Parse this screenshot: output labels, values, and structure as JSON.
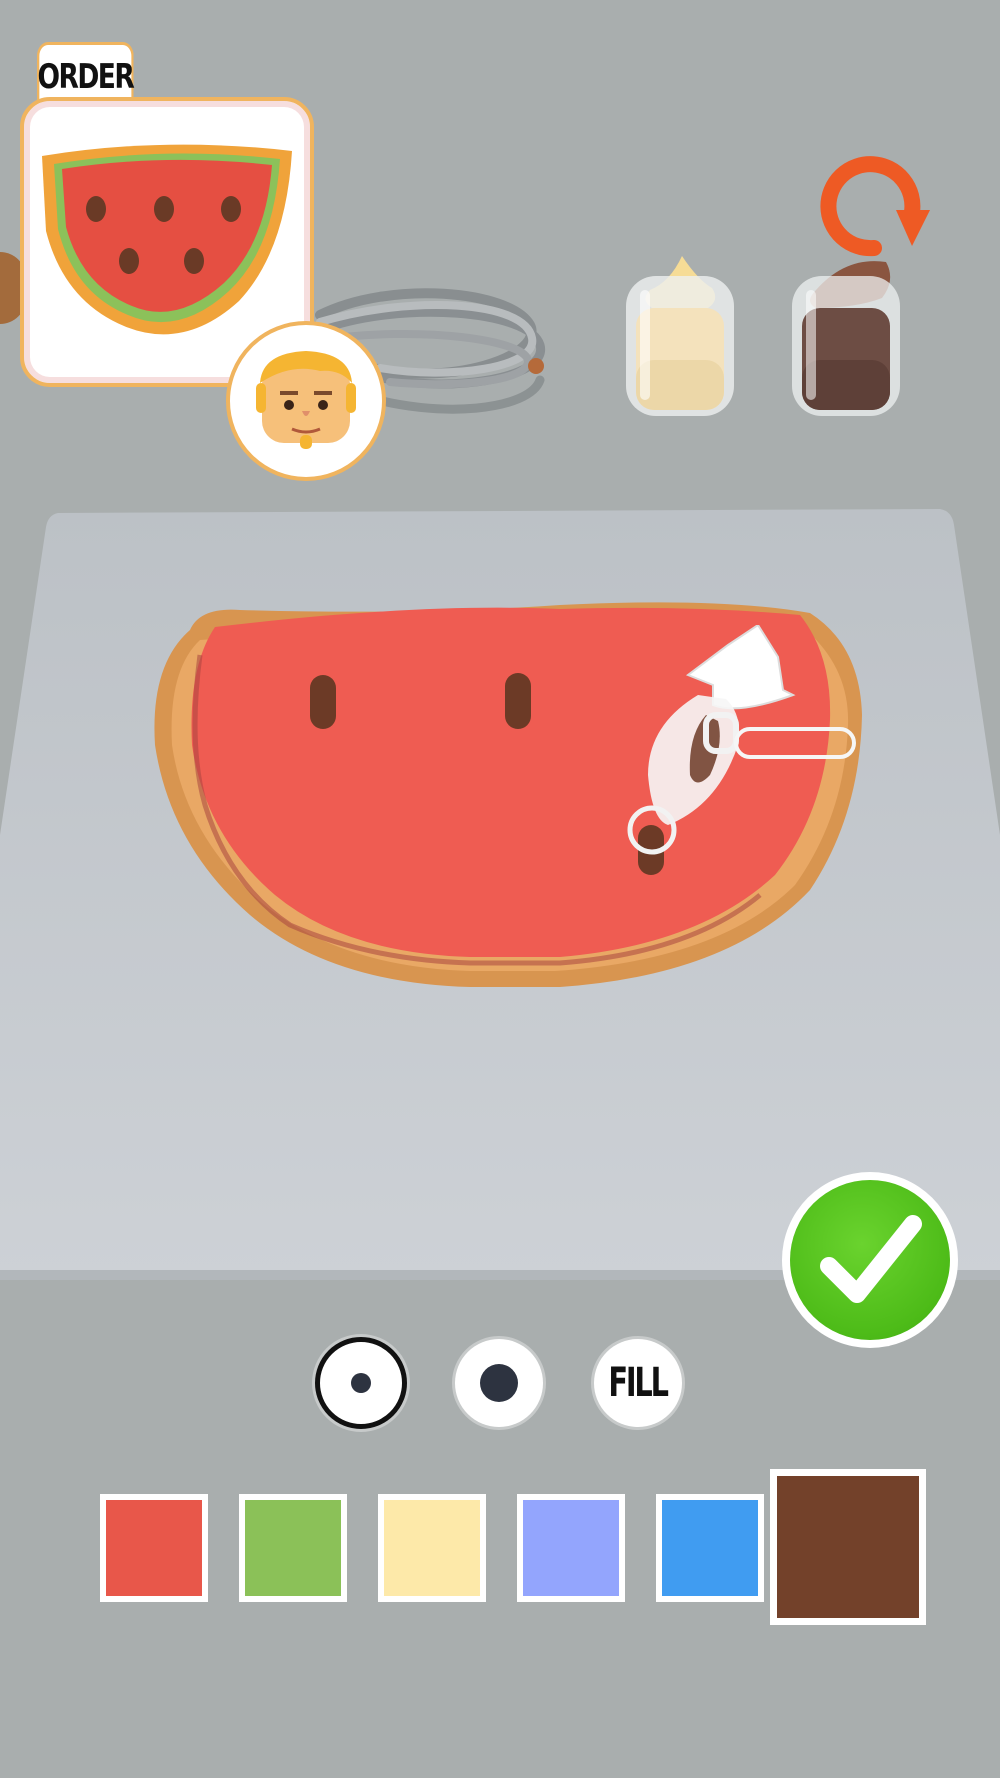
{
  "order": {
    "label": "ORDER"
  },
  "tools": [
    {
      "name": "small-brush",
      "selected": true
    },
    {
      "name": "large-brush",
      "selected": false
    },
    {
      "name": "fill",
      "label": "FILL",
      "selected": false
    }
  ],
  "palette": {
    "swatches": [
      "#e8574a",
      "#8bc158",
      "#fde9a9",
      "#93a5fd",
      "#409cf1",
      "#73412a"
    ],
    "selected_index": 5
  },
  "colors": {
    "background": "#a9aeae",
    "accent_orange": "#f0b45e",
    "reset": "#ee5a24",
    "confirm": "#4dbb18",
    "icing": "#ef5c52"
  },
  "icons": [
    "reset-icon",
    "checkmark-icon",
    "whisk-icon",
    "piping-bag-icon"
  ]
}
